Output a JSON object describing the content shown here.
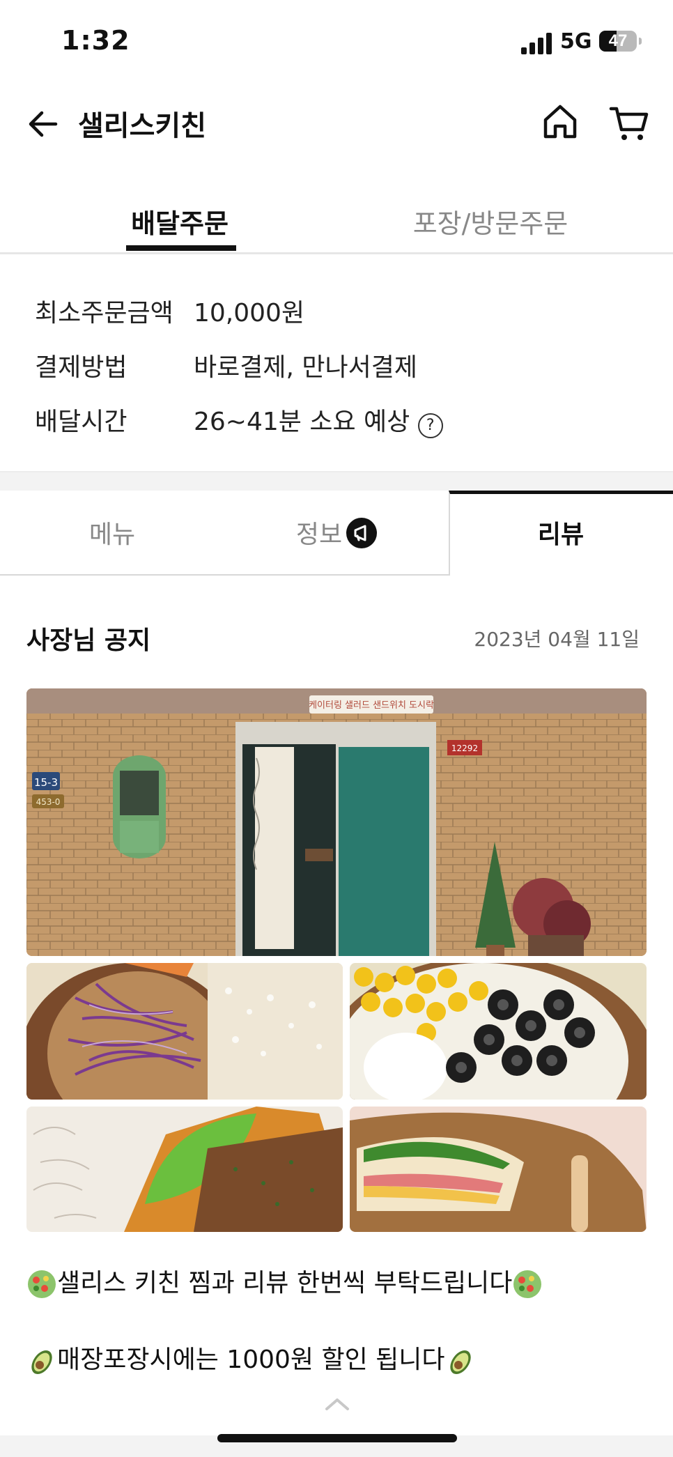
{
  "status_bar": {
    "time": "1:32",
    "network": "5G",
    "battery": "47",
    "battery_level": 0.47
  },
  "header": {
    "title": "샐리스키친",
    "icons": [
      "back-arrow-icon",
      "home-icon",
      "cart-icon"
    ]
  },
  "order_tabs": {
    "active": "배달주문",
    "inactive": "포장/방문주문"
  },
  "store_info": [
    {
      "label": "최소주문금액",
      "value": "10,000원"
    },
    {
      "label": "결제방법",
      "value": "바로결제, 만나서결제"
    },
    {
      "label": "배달시간",
      "value": "26~41분 소요 예상"
    }
  ],
  "store_info_help": "?",
  "content_tabs": {
    "menu": "메뉴",
    "info": "정보",
    "review": "리뷰",
    "selected": "리뷰"
  },
  "notice": {
    "title": "사장님 공지",
    "date": "2023년 04월 11일",
    "sign_text": "케이터링 샐러드 샌드위치 도시락",
    "address_plate": "15-3",
    "address_small": "453-0",
    "house_number": "12292",
    "lines": [
      "샐리스 키친 찜과 리뷰 한번씩 부탁드립니다",
      "매장포장시에는 1000원 할인 됩니다"
    ]
  },
  "colors": {
    "text": "#111111",
    "muted": "#888888",
    "divider": "#e6e6e6",
    "band": "#f3f3f3"
  }
}
